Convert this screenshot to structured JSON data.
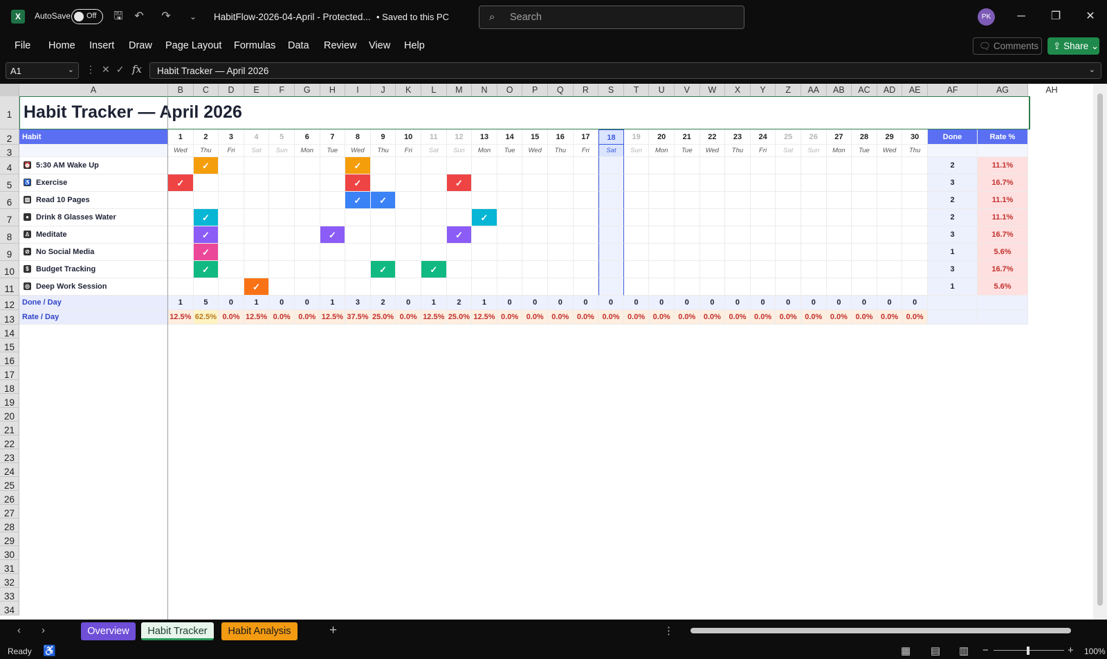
{
  "titlebar": {
    "autosave_label": "AutoSave",
    "autosave_state": "Off",
    "document_title": "HabitFlow-2026-04-April  -  Protected...",
    "save_status": "• Saved to this PC",
    "search_placeholder": "Search",
    "avatar_initials": "PK"
  },
  "menu": [
    "File",
    "Home",
    "Insert",
    "Draw",
    "Page Layout",
    "Formulas",
    "Data",
    "Review",
    "View",
    "Help"
  ],
  "actions": {
    "comments": "Comments",
    "share": "Share"
  },
  "formula_bar": {
    "name_box": "A1",
    "formula": "Habit Tracker — April 2026"
  },
  "columns": [
    "A",
    "B",
    "C",
    "D",
    "E",
    "F",
    "G",
    "H",
    "I",
    "J",
    "K",
    "L",
    "M",
    "N",
    "O",
    "P",
    "Q",
    "R",
    "S",
    "T",
    "U",
    "V",
    "W",
    "X",
    "Y",
    "Z",
    "AA",
    "AB",
    "AC",
    "AD",
    "AE",
    "AF",
    "AG",
    "AH"
  ],
  "rows": [
    "1",
    "2",
    "3",
    "4",
    "5",
    "6",
    "7",
    "8",
    "9",
    "10",
    "11",
    "12",
    "13",
    "14",
    "15",
    "16",
    "17",
    "18",
    "19",
    "20",
    "21",
    "22",
    "23",
    "24",
    "25",
    "26",
    "27",
    "28",
    "29",
    "30",
    "31",
    "32",
    "33",
    "34"
  ],
  "sheet": {
    "title": "Habit Tracker  —  April 2026",
    "habit_header": "Habit",
    "done_header": "Done",
    "rate_header": "Rate %",
    "days": [
      "1",
      "2",
      "3",
      "4",
      "5",
      "6",
      "7",
      "8",
      "9",
      "10",
      "11",
      "12",
      "13",
      "14",
      "15",
      "16",
      "17",
      "18",
      "19",
      "20",
      "21",
      "22",
      "23",
      "24",
      "25",
      "26",
      "27",
      "28",
      "29",
      "30"
    ],
    "weekdays": [
      "Wed",
      "Thu",
      "Fri",
      "Sat",
      "Sun",
      "Mon",
      "Tue",
      "Wed",
      "Thu",
      "Fri",
      "Sat",
      "Sun",
      "Mon",
      "Tue",
      "Wed",
      "Thu",
      "Fri",
      "Sat",
      "Sun",
      "Mon",
      "Tue",
      "Wed",
      "Thu",
      "Fri",
      "Sat",
      "Sun",
      "Mon",
      "Tue",
      "Wed",
      "Thu"
    ],
    "today_day": 18,
    "check_mark": "✓",
    "habits": [
      {
        "name": "5:30 AM Wake Up",
        "icon": "alarm-icon",
        "color": "#f59e0b",
        "done_days": [
          2,
          8
        ],
        "done": "2",
        "rate": "11.1%"
      },
      {
        "name": "Exercise",
        "icon": "exercise-icon",
        "color": "#ef4444",
        "done_days": [
          1,
          8,
          12
        ],
        "done": "3",
        "rate": "16.7%"
      },
      {
        "name": "Read 10 Pages",
        "icon": "book-icon",
        "color": "#3b82f6",
        "done_days": [
          8,
          9
        ],
        "done": "2",
        "rate": "11.1%"
      },
      {
        "name": "Drink 8 Glasses Water",
        "icon": "water-drop-icon",
        "color": "#06b6d4",
        "done_days": [
          2,
          13
        ],
        "done": "2",
        "rate": "11.1%"
      },
      {
        "name": "Meditate",
        "icon": "meditate-icon",
        "color": "#8b5cf6",
        "done_days": [
          2,
          7,
          12
        ],
        "done": "3",
        "rate": "16.7%"
      },
      {
        "name": "No Social Media",
        "icon": "no-social-icon",
        "color": "#ec4899",
        "done_days": [
          2
        ],
        "done": "1",
        "rate": "5.6%"
      },
      {
        "name": "Budget Tracking",
        "icon": "money-bag-icon",
        "color": "#10b981",
        "done_days": [
          2,
          9,
          11
        ],
        "done": "3",
        "rate": "16.7%"
      },
      {
        "name": "Deep Work Session",
        "icon": "target-icon",
        "color": "#f97316",
        "done_days": [
          4
        ],
        "done": "1",
        "rate": "5.6%"
      }
    ],
    "done_per_day_label": "Done / Day",
    "done_per_day": [
      "1",
      "5",
      "0",
      "1",
      "0",
      "0",
      "1",
      "3",
      "2",
      "0",
      "1",
      "2",
      "1",
      "0",
      "0",
      "0",
      "0",
      "0",
      "0",
      "0",
      "0",
      "0",
      "0",
      "0",
      "0",
      "0",
      "0",
      "0",
      "0",
      "0"
    ],
    "rate_per_day_label": "Rate / Day",
    "rate_per_day": [
      "12.5%",
      "62.5%",
      "0.0%",
      "12.5%",
      "0.0%",
      "0.0%",
      "12.5%",
      "37.5%",
      "25.0%",
      "0.0%",
      "12.5%",
      "25.0%",
      "12.5%",
      "0.0%",
      "0.0%",
      "0.0%",
      "0.0%",
      "0.0%",
      "0.0%",
      "0.0%",
      "0.0%",
      "0.0%",
      "0.0%",
      "0.0%",
      "0.0%",
      "0.0%",
      "0.0%",
      "0.0%",
      "0.0%",
      "0.0%"
    ]
  },
  "sheet_tabs": [
    {
      "label": "Overview",
      "active": false,
      "color": "#6f4ed8"
    },
    {
      "label": "Habit Tracker",
      "active": true,
      "color": "#2b9a5a"
    },
    {
      "label": "Habit Analysis",
      "active": false,
      "color": "#f29a12"
    }
  ],
  "status": {
    "ready": "Ready",
    "zoom": "100%"
  }
}
